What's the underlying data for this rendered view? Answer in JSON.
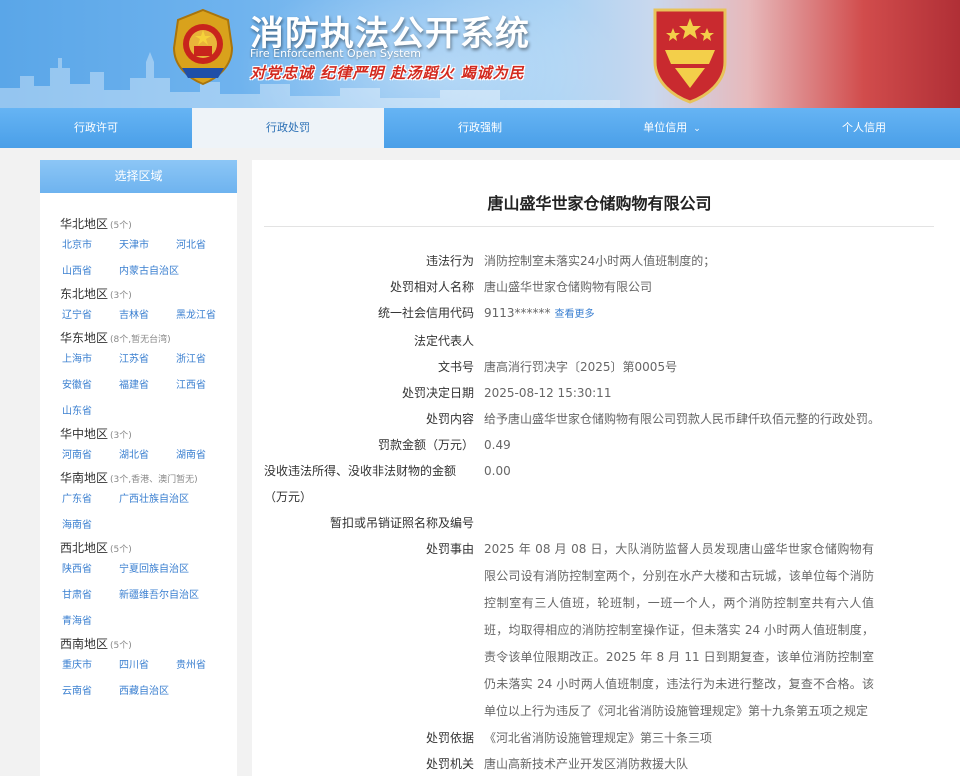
{
  "header": {
    "title_cn": "消防执法公开系统",
    "title_en": "Fire Enforcement Open System",
    "slogan": "对党忠诚 纪律严明 赴汤蹈火 竭诚为民"
  },
  "nav": {
    "items": [
      {
        "label": "行政许可"
      },
      {
        "label": "行政处罚"
      },
      {
        "label": "行政强制"
      },
      {
        "label": "单位信用"
      },
      {
        "label": "个人信用"
      }
    ],
    "active_index": 1
  },
  "sidebar": {
    "title": "选择区域",
    "regions": [
      {
        "name": "华北地区",
        "note": "(5个)",
        "provinces": [
          "北京市",
          "天津市",
          "河北省",
          "山西省",
          "内蒙古自治区"
        ]
      },
      {
        "name": "东北地区",
        "note": "(3个)",
        "provinces": [
          "辽宁省",
          "吉林省",
          "黑龙江省"
        ]
      },
      {
        "name": "华东地区",
        "note": "(8个,暂无台湾)",
        "provinces": [
          "上海市",
          "江苏省",
          "浙江省",
          "安徽省",
          "福建省",
          "江西省",
          "山东省"
        ]
      },
      {
        "name": "华中地区",
        "note": "(3个)",
        "provinces": [
          "河南省",
          "湖北省",
          "湖南省"
        ]
      },
      {
        "name": "华南地区",
        "note": "(3个,香港、澳门暂无)",
        "provinces": [
          "广东省",
          "广西壮族自治区",
          "海南省"
        ]
      },
      {
        "name": "西北地区",
        "note": "(5个)",
        "provinces": [
          "陕西省",
          "宁夏回族自治区",
          "甘肃省",
          "新疆维吾尔自治区",
          "青海省"
        ]
      },
      {
        "name": "西南地区",
        "note": "(5个)",
        "provinces": [
          "重庆市",
          "四川省",
          "贵州省",
          "云南省",
          "西藏自治区"
        ]
      }
    ]
  },
  "main": {
    "company": "唐山盛华世家仓储购物有限公司",
    "fields": {
      "violation_label": "违法行为",
      "violation": "消防控制室未落实24小时两人值班制度的；",
      "party_label": "处罚相对人名称",
      "party": "唐山盛华世家仓储购物有限公司",
      "credit_label": "统一社会信用代码",
      "credit": "9113******",
      "credit_more": "查看更多",
      "legal_rep_label": "法定代表人",
      "legal_rep": "",
      "doc_no_label": "文书号",
      "doc_no": "唐高消行罚决字〔2025〕第0005号",
      "date_label": "处罚决定日期",
      "date": "2025-08-12 15:30:11",
      "content_label": "处罚内容",
      "content": "给予唐山盛华世家仓储购物有限公司罚款人民币肆仟玖佰元整的行政处罚。",
      "fine_label": "罚款金额（万元）",
      "fine": "0.49",
      "confiscation_label": "没收违法所得、没收非法财物的金额（万元）",
      "confiscation": "0.00",
      "license_label": "暂扣或吊销证照名称及编号",
      "license": "",
      "reason_label": "处罚事由",
      "reason": "2025 年 08 月 08 日，大队消防监督人员发现唐山盛华世家仓储购物有限公司设有消防控制室两个，分别在水产大楼和古玩城，该单位每个消防控制室有三人值班，轮班制，一班一个人，两个消防控制室共有六人值班，均取得相应的消防控制室操作证，但未落实 24 小时两人值班制度，责令该单位限期改正。2025 年 8 月 11 日到期复查，该单位消防控制室仍未落实 24 小时两人值班制度，违法行为未进行整改，复查不合格。该单位以上行为违反了《河北省消防设施管理规定》第十九条第五项之规定",
      "basis_label": "处罚依据",
      "basis": "《河北省消防设施管理规定》第三十条三项",
      "authority_label": "处罚机关",
      "authority": "唐山高新技术产业开发区消防救援大队"
    }
  }
}
